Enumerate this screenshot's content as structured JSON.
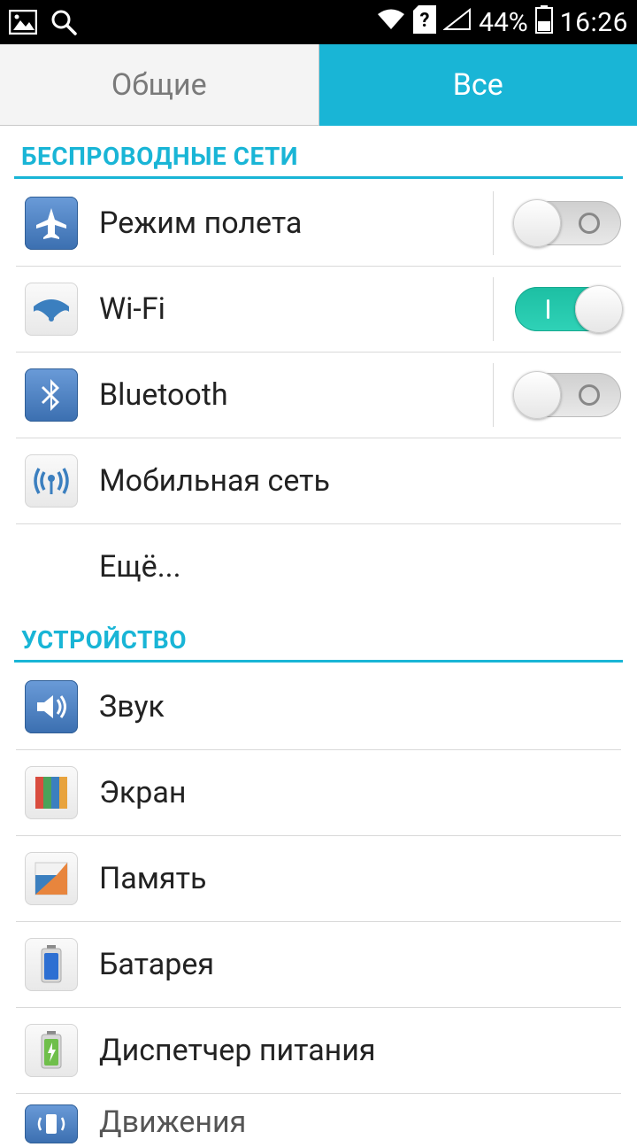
{
  "status": {
    "battery_percent": "44%",
    "time": "16:26"
  },
  "tabs": {
    "general": "Общие",
    "all": "Все"
  },
  "sections": {
    "wireless": "БЕСПРОВОДНЫЕ СЕТИ",
    "device": "УСТРОЙСТВО"
  },
  "items": {
    "airplane": "Режим полета",
    "wifi": "Wi-Fi",
    "bluetooth": "Bluetooth",
    "mobile": "Мобильная сеть",
    "more": "Ещё...",
    "sound": "Звук",
    "display": "Экран",
    "storage": "Память",
    "battery": "Батарея",
    "power": "Диспетчер питания",
    "motion": "Движения"
  },
  "toggles": {
    "airplane": false,
    "wifi": true,
    "bluetooth": false
  }
}
